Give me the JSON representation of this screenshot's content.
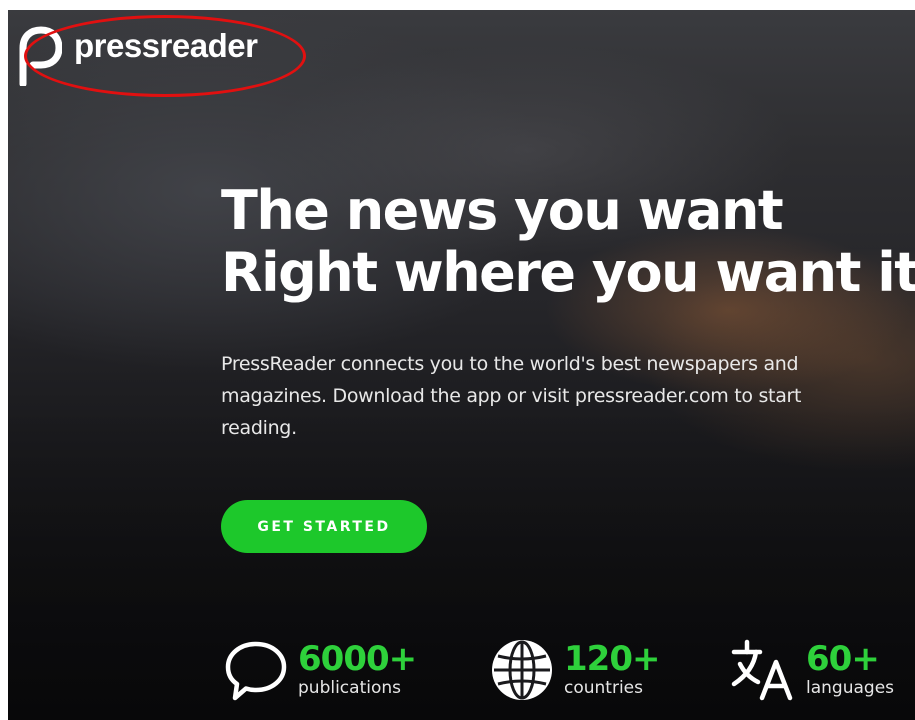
{
  "brand": {
    "name": "pressreader"
  },
  "hero": {
    "headline_line1": "The news you want",
    "headline_line2": "Right where you want it",
    "intro": "PressReader connects you to the world's best newspapers and magazines. Download the app or visit pressreader.com to start reading.",
    "cta_label": "GET STARTED"
  },
  "stats": [
    {
      "value": "6000+",
      "label": "publications",
      "icon": "speech-bubble-icon"
    },
    {
      "value": "120+",
      "label": "countries",
      "icon": "globe-icon"
    },
    {
      "value": "60+",
      "label": "languages",
      "icon": "translate-icon"
    }
  ],
  "colors": {
    "accent": "#1dc82b",
    "stat_value": "#2ed13b",
    "highlight": "#e11010",
    "text": "#ffffff"
  }
}
